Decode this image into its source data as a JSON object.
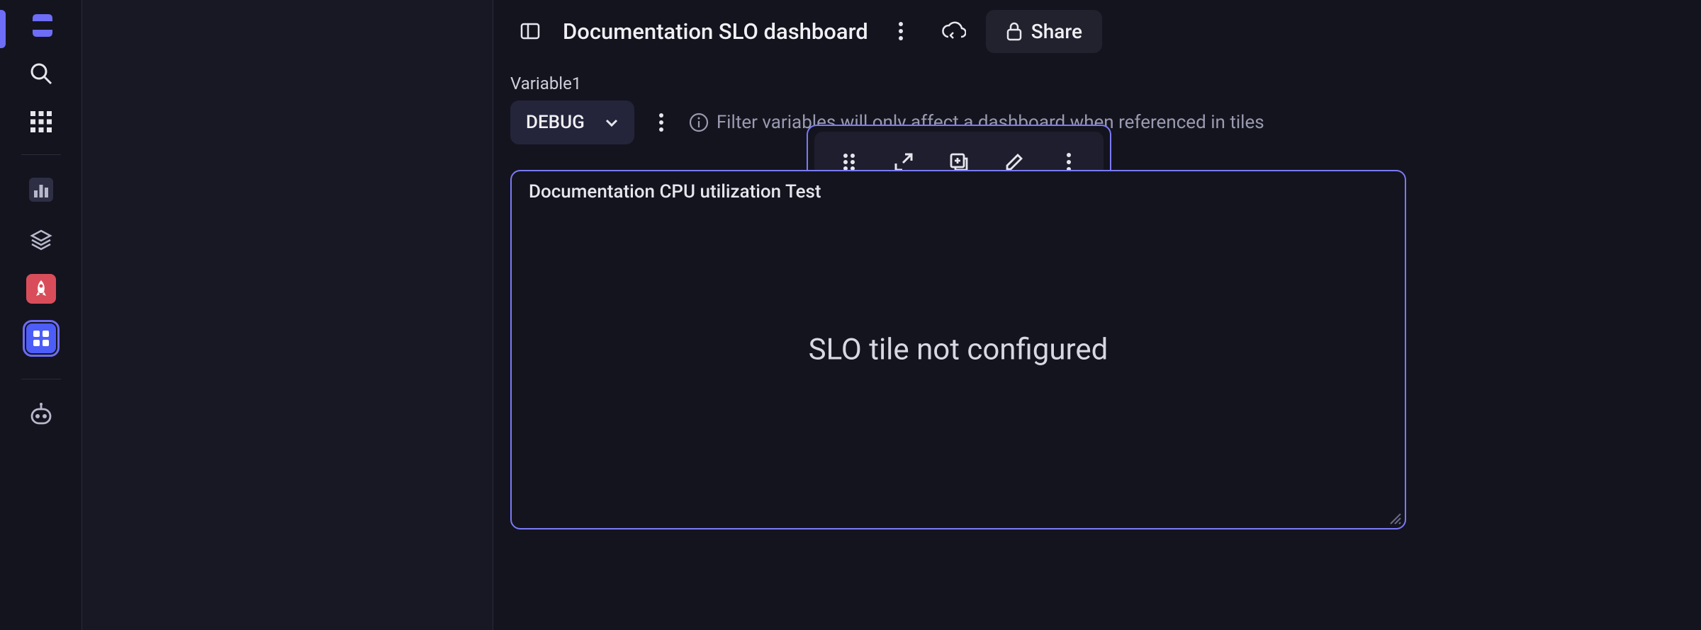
{
  "colors": {
    "accent": "#7a7af7",
    "bg": "#14141f",
    "panel": "#181824",
    "chip": "#24243a",
    "text": "#e6e6ed",
    "muted": "#9a9ab0"
  },
  "rail": {
    "logo_name": "dynatrace-logo-icon",
    "items": [
      {
        "name": "search-icon"
      },
      {
        "name": "apps-grid-icon"
      }
    ],
    "apps": [
      {
        "name": "bar-chart-icon",
        "active": false
      },
      {
        "name": "stack-icon",
        "active": false
      },
      {
        "name": "rocket-icon",
        "active": false,
        "bg": "#d94d5a"
      },
      {
        "name": "dashboard-app-icon",
        "active": true,
        "bg": "#4d5df7"
      }
    ],
    "footer_icon": "bot-icon"
  },
  "header": {
    "nav_toggle_icon": "panel-left-icon",
    "title": "Documentation SLO dashboard",
    "more_icon": "more-vertical-icon",
    "sync_icon": "cloud-sync-icon",
    "share": {
      "icon": "lock-icon",
      "label": "Share"
    }
  },
  "variables": {
    "label": "Variable1",
    "value": "DEBUG",
    "dropdown_icon": "chevron-down-icon",
    "more_icon": "more-vertical-icon",
    "info_icon": "info-icon",
    "info_text": "Filter variables will only affect a dashboard when referenced in tiles"
  },
  "tile": {
    "title": "Documentation CPU utilization Test",
    "empty_message": "SLO tile not configured",
    "resize_icon": "resize-handle-icon",
    "toolbar": [
      {
        "name": "drag-handle-icon",
        "interactable": true
      },
      {
        "name": "expand-icon",
        "interactable": true
      },
      {
        "name": "duplicate-icon",
        "interactable": true
      },
      {
        "name": "edit-icon",
        "interactable": true
      },
      {
        "name": "more-vertical-icon",
        "interactable": true
      }
    ]
  }
}
